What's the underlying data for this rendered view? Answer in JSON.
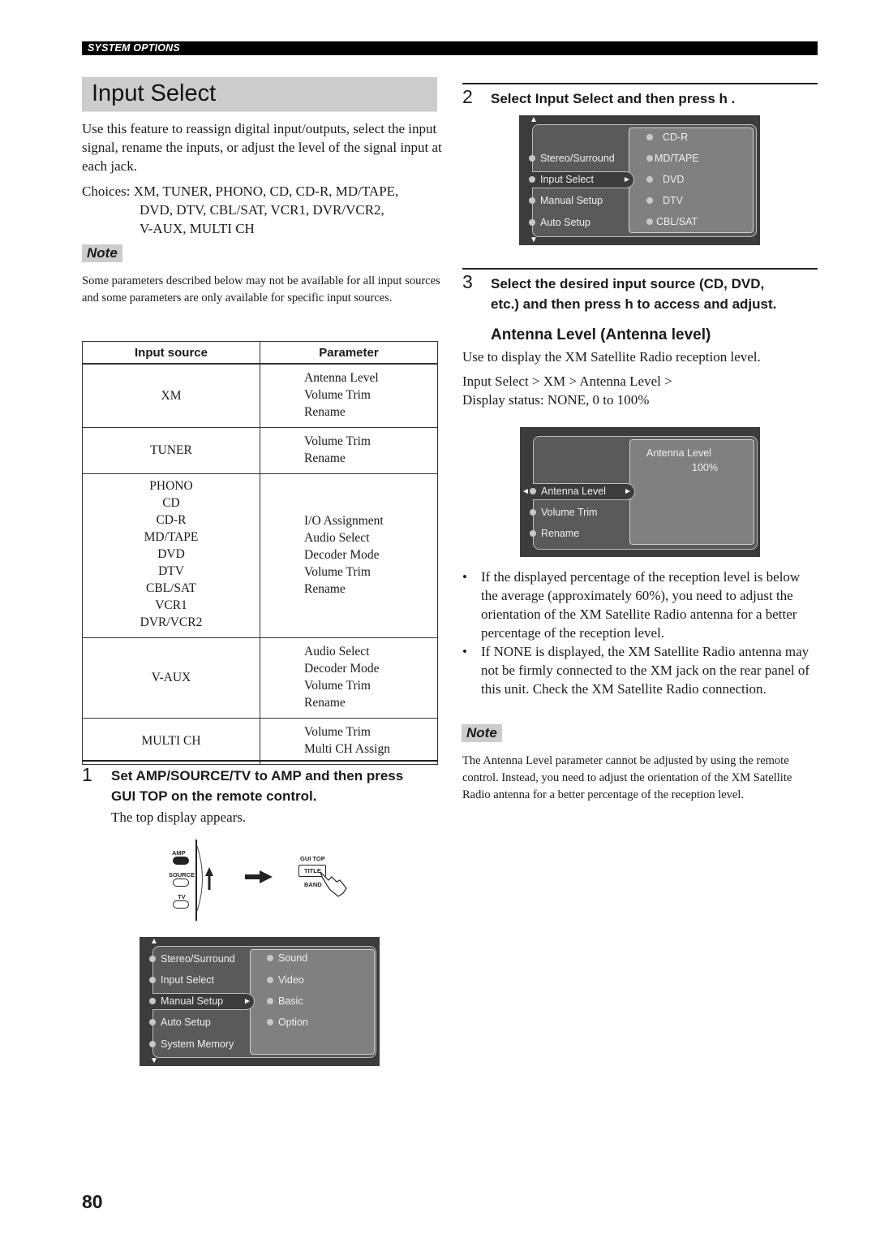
{
  "header": {
    "section": "SYSTEM OPTIONS"
  },
  "page_title": "Input Select",
  "intro": "Use this feature to reassign digital input/outputs, select the input signal, rename the inputs, or adjust the level of the signal input at each jack.",
  "choices": {
    "line1": "Choices: XM, TUNER, PHONO, CD, CD-R, MD/TAPE,",
    "line2": "DVD, DTV, CBL/SAT, VCR1, DVR/VCR2,",
    "line3": "V-AUX, MULTI CH"
  },
  "note1": {
    "label": "Note",
    "text": "Some parameters described below may not be available for all input sources and some parameters are only available for specific input sources."
  },
  "table": {
    "headers": [
      "Input source",
      "Parameter"
    ],
    "rows": [
      {
        "sources": [
          "XM"
        ],
        "params": [
          "Antenna Level",
          "Volume Trim",
          "Rename"
        ]
      },
      {
        "sources": [
          "TUNER"
        ],
        "params": [
          "Volume Trim",
          "Rename"
        ]
      },
      {
        "sources": [
          "PHONO",
          "CD",
          "CD-R",
          "MD/TAPE",
          "DVD",
          "DTV",
          "CBL/SAT",
          "VCR1",
          "DVR/VCR2"
        ],
        "params": [
          "I/O Assignment",
          "Audio Select",
          "Decoder Mode",
          "Volume Trim",
          "Rename"
        ]
      },
      {
        "sources": [
          "V-AUX"
        ],
        "params": [
          "Audio Select",
          "Decoder Mode",
          "Volume Trim",
          "Rename"
        ]
      },
      {
        "sources": [
          "MULTI CH"
        ],
        "params": [
          "Volume Trim",
          "Multi CH Assign"
        ]
      }
    ]
  },
  "step1": {
    "num": "1",
    "line1": "Set AMP/SOURCE/TV to AMP and then press",
    "line2": "GUI TOP on the remote control.",
    "sub": "The top display appears."
  },
  "remote": {
    "amp": "AMP",
    "source": "SOURCE",
    "tv": "TV",
    "gui_top": "GUI TOP",
    "title": "TITLE",
    "band": "BAND"
  },
  "osd_top": {
    "left_items": [
      "Stereo/Surround",
      "Input Select",
      "Manual Setup",
      "Auto Setup",
      "System Memory"
    ],
    "selected_index": 2,
    "right_items": [
      "Sound",
      "Video",
      "Basic",
      "Option"
    ]
  },
  "step2": {
    "num": "2",
    "text": "Select Input Select and then press h ."
  },
  "osd_input": {
    "left_items": [
      "Stereo/Surround",
      "Input Select",
      "Manual Setup",
      "Auto Setup"
    ],
    "selected_index": 1,
    "right_items": [
      "CD-R",
      "MD/TAPE",
      "DVD",
      "DTV",
      "CBL/SAT"
    ]
  },
  "step3": {
    "num": "3",
    "line1": "Select the desired input source (CD, DVD,",
    "line2": "etc.) and then press h  to access and adjust."
  },
  "antenna": {
    "heading": "Antenna Level (Antenna level)",
    "desc": "Use to display the XM Satellite Radio reception level.",
    "path": "Input Select > XM > Antenna Level >",
    "status": "Display status: NONE, 0 to 100%"
  },
  "osd_antenna": {
    "left_items": [
      "Antenna Level",
      "Volume Trim",
      "Rename"
    ],
    "selected_index": 0,
    "panel_label": "Antenna Level",
    "panel_value": "100%"
  },
  "bullets": [
    "If the displayed percentage of the reception level is below the average (approximately 60%), you need to adjust the orientation of the XM Satellite Radio antenna for a better percentage of the reception level.",
    "If NONE is displayed, the XM Satellite Radio antenna may not be firmly connected to the XM jack on the rear panel of this unit. Check the XM Satellite Radio connection."
  ],
  "bullet_glyph": "•",
  "note2": {
    "label": "Note",
    "text": "The Antenna Level parameter cannot be adjusted by using the remote control. Instead, you need to adjust the orientation of the XM Satellite Radio antenna for a better percentage of the reception level."
  },
  "page_number": "80"
}
